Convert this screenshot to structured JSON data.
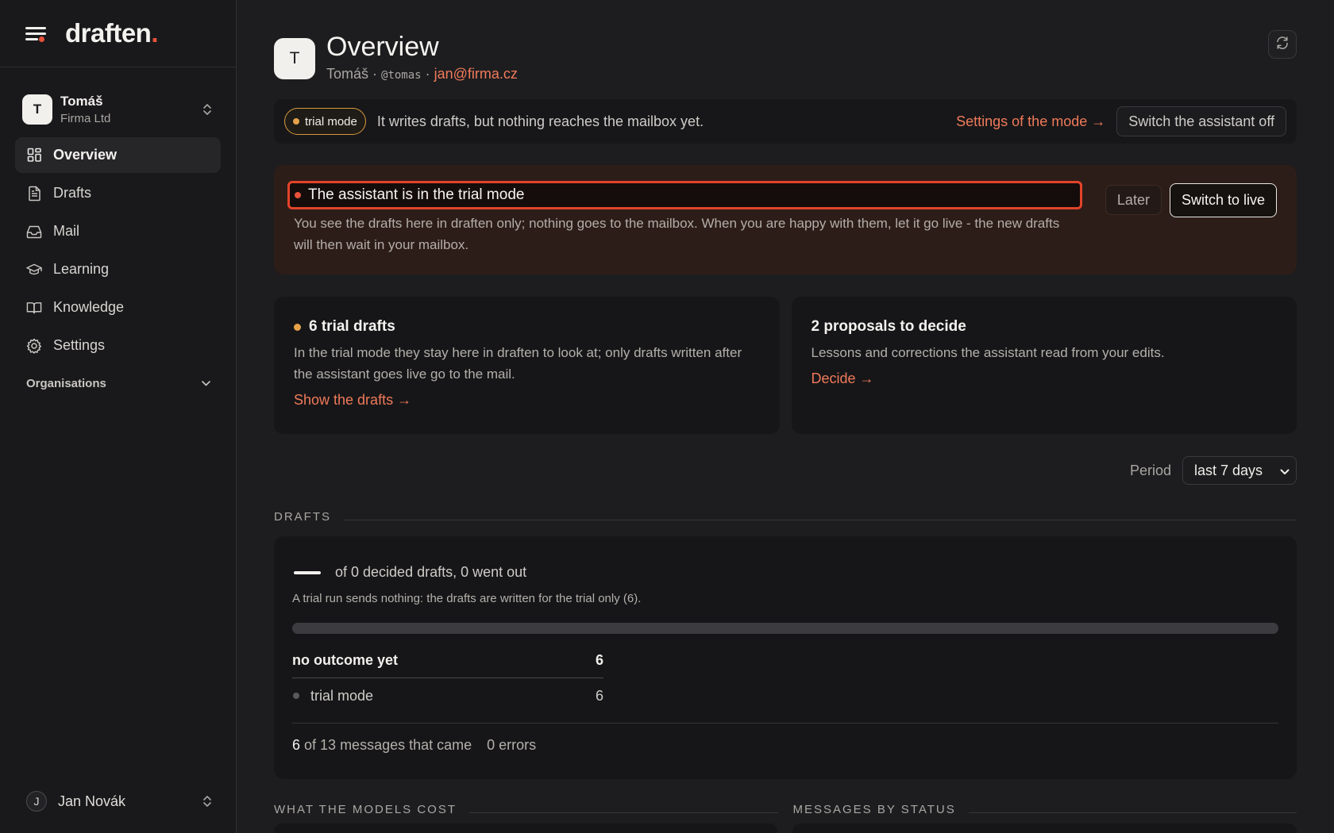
{
  "brand": {
    "name": "draften",
    "dot": "."
  },
  "account": {
    "initial": "T",
    "name": "Tomáš",
    "org": "Firma Ltd"
  },
  "nav": [
    {
      "label": "Overview",
      "icon": "grid-icon",
      "active": true
    },
    {
      "label": "Drafts",
      "icon": "document-icon"
    },
    {
      "label": "Mail",
      "icon": "inbox-icon"
    },
    {
      "label": "Learning",
      "icon": "graduation-cap-icon"
    },
    {
      "label": "Knowledge",
      "icon": "book-icon"
    },
    {
      "label": "Settings",
      "icon": "gear-icon"
    }
  ],
  "organisations_label": "Organisations",
  "user": {
    "initial": "J",
    "name": "Jan Novák"
  },
  "header": {
    "initial": "T",
    "title": "Overview",
    "name": "Tomáš",
    "sep": " · ",
    "handle": "@tomas",
    "email": "jan@firma.cz"
  },
  "mode_bar": {
    "badge": "trial mode",
    "text": "It writes drafts, but nothing reaches the mailbox yet.",
    "settings_link": "Settings of the mode →",
    "switch_off": "Switch the assistant off"
  },
  "alert": {
    "title": "The assistant is in the trial mode",
    "body": "You see the drafts here in draften only; nothing goes to the mailbox. When you are happy with them, let it go live - the new drafts will then wait in your mailbox.",
    "later": "Later",
    "live": "Switch to live"
  },
  "cards": {
    "drafts": {
      "title": "6 trial drafts",
      "text": "In the trial mode they stay here in draften to look at; only drafts written after the assistant goes live go to the mail.",
      "link": "Show the drafts →"
    },
    "proposals": {
      "title": "2 proposals to decide",
      "text": "Lessons and corrections the assistant read from your edits.",
      "link": "Decide →"
    }
  },
  "period": {
    "label": "Period",
    "value": "last 7 days"
  },
  "drafts_section": {
    "title": "DRAFTS",
    "metric": "of 0 decided drafts, 0 went out",
    "note": "A trial run sends nothing: the drafts are written for the trial only (6).",
    "progress": 0,
    "rows": [
      {
        "label": "no outcome yet",
        "value": "6"
      },
      {
        "label": "trial mode",
        "value": "6"
      }
    ],
    "foot": {
      "count": "6",
      "of_text": "of 13 messages that came",
      "errors": "0 errors"
    }
  },
  "bottom_sections": {
    "costs": "WHAT THE MODELS COST",
    "status": "MESSAGES BY STATUS"
  },
  "colors": {
    "accent": "#f07a5a",
    "alert_border": "#e2432a",
    "trial_dot": "#e6a24a",
    "background": "#1d1d1f"
  }
}
